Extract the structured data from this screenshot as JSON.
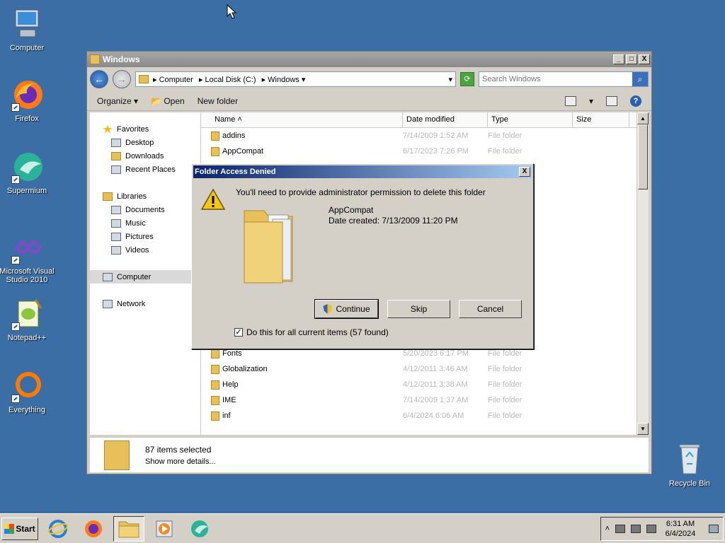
{
  "desktop": {
    "icons": [
      {
        "label": "Computer"
      },
      {
        "label": "Firefox"
      },
      {
        "label": "Supermium"
      },
      {
        "label": "Microsoft Visual Studio 2010"
      },
      {
        "label": "Notepad++"
      },
      {
        "label": "Everything"
      },
      {
        "label": "Recycle Bin"
      }
    ]
  },
  "window": {
    "title": "Windows",
    "controls": {
      "minimize": "_",
      "maximize": "□",
      "close": "X"
    },
    "address": {
      "crumbs": [
        "Computer",
        "Local Disk (C:)",
        "Windows"
      ]
    },
    "search": {
      "placeholder": "Search Windows"
    },
    "toolbar": {
      "organize": "Organize",
      "open": "Open",
      "new_folder": "New folder"
    },
    "nav": {
      "favorites": "Favorites",
      "desktop": "Desktop",
      "downloads": "Downloads",
      "recent": "Recent Places",
      "libraries": "Libraries",
      "documents": "Documents",
      "music": "Music",
      "pictures": "Pictures",
      "videos": "Videos",
      "computer": "Computer",
      "network": "Network"
    },
    "columns": {
      "name": "Name",
      "date": "Date modified",
      "type": "Type",
      "size": "Size"
    },
    "files": [
      {
        "name": "addins",
        "date": "7/14/2009 1:52 AM",
        "type": "File folder"
      },
      {
        "name": "AppCompat",
        "date": "6/17/2023 7:26 PM",
        "type": "File folder"
      },
      {
        "name": "Fonts",
        "date": "5/20/2023 6:17 PM",
        "type": "File folder"
      },
      {
        "name": "Globalization",
        "date": "4/12/2011 3:46 AM",
        "type": "File folder"
      },
      {
        "name": "Help",
        "date": "4/12/2011 3:38 AM",
        "type": "File folder"
      },
      {
        "name": "IME",
        "date": "7/14/2009 1:37 AM",
        "type": "File folder"
      },
      {
        "name": "inf",
        "date": "6/4/2024 6:06 AM",
        "type": "File folder"
      }
    ],
    "details": {
      "selected": "87 items selected",
      "more": "Show more details..."
    }
  },
  "dialog": {
    "title": "Folder Access Denied",
    "close": "X",
    "message": "You'll need to provide administrator permission to delete this folder",
    "folder_name": "AppCompat",
    "folder_date": "Date created: 7/13/2009 11:20 PM",
    "buttons": {
      "continue": "Continue",
      "skip": "Skip",
      "cancel": "Cancel"
    },
    "checkbox": {
      "label": "Do this for all current items (57 found)",
      "checked": true
    }
  },
  "taskbar": {
    "start": "Start",
    "clock_time": "6:31 AM",
    "clock_date": "6/4/2024"
  }
}
